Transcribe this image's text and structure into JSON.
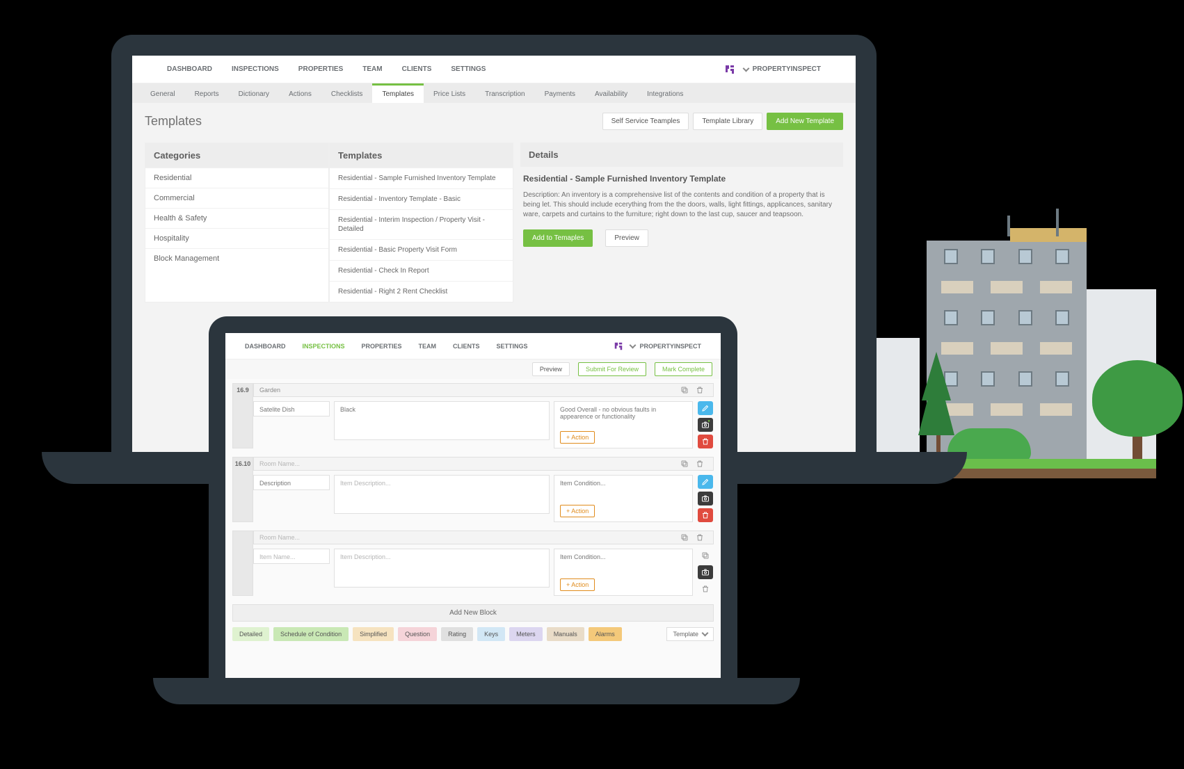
{
  "brand": "PROPERTYINSPECT",
  "nav": [
    "DASHBOARD",
    "INSPECTIONS",
    "PROPERTIES",
    "TEAM",
    "CLIENTS",
    "SETTINGS"
  ],
  "subtabs": [
    "General",
    "Reports",
    "Dictionary",
    "Actions",
    "Checklists",
    "Templates",
    "Price Lists",
    "Transcription",
    "Payments",
    "Availability",
    "Integrations"
  ],
  "active_subtab": "Templates",
  "page_title": "Templates",
  "page_buttons": {
    "self_service": "Self Service Teamples",
    "library": "Template Library",
    "add_new": "Add New Template"
  },
  "columns": {
    "categories": "Categories",
    "templates": "Templates",
    "details": "Details"
  },
  "categories": [
    "Residential",
    "Commercial",
    "Health & Safety",
    "Hospitality",
    "Block Management"
  ],
  "templates_list": [
    "Residential - Sample Furnished Inventory Template",
    "Residential - Inventory Template - Basic",
    "Residential - Interim Inspection / Property Visit - Detailed",
    "Residential - Basic Property Visit Form",
    "Residential - Check In Report",
    "Residential - Right 2 Rent Checklist"
  ],
  "details": {
    "title": "Residential - Sample Furnished Inventory Template",
    "desc": "Description: An inventory is a comprehensive list of the contents and condition of a property that is being let. This should include ecerything from the the doors, walls, light fittings, applicances, sanitary ware, carpets and curtains to the furniture; right down to the last cup, saucer and teapsoon.",
    "add": "Add to Temaples",
    "preview": "Preview"
  },
  "l2": {
    "nav_active": "INSPECTIONS",
    "toolbar": {
      "preview": "Preview",
      "submit": "Submit For Review",
      "complete": "Mark Complete"
    },
    "room_placeholder": "Room Name...",
    "itemname_placeholder": "Item Name...",
    "itemdesc_placeholder": "Item Description...",
    "itemcond_placeholder": "Item Condition...",
    "action_label": "+ Action",
    "add_block": "Add New Block",
    "b1": {
      "num": "16.9",
      "room": "Garden",
      "item": "Satelite Dish",
      "desc": "Black",
      "cond": "Good Overall - no obvious faults in appearence or functionality",
      "desc_label": "Description"
    },
    "b2": {
      "num": "16.10",
      "desc_label": "Description"
    },
    "chips": [
      {
        "label": "Detailed",
        "color": "#dff2d0"
      },
      {
        "label": "Schedule of Condition",
        "color": "#c9e8b5"
      },
      {
        "label": "Simplified",
        "color": "#f6e3c0"
      },
      {
        "label": "Question",
        "color": "#f5d4d9"
      },
      {
        "label": "Rating",
        "color": "#e0e0e0"
      },
      {
        "label": "Keys",
        "color": "#d2e7f5"
      },
      {
        "label": "Meters",
        "color": "#dcd6f0"
      },
      {
        "label": "Manuals",
        "color": "#e9dcc8"
      },
      {
        "label": "Alarms",
        "color": "#f4c97a"
      }
    ],
    "template_selector": "Template"
  }
}
